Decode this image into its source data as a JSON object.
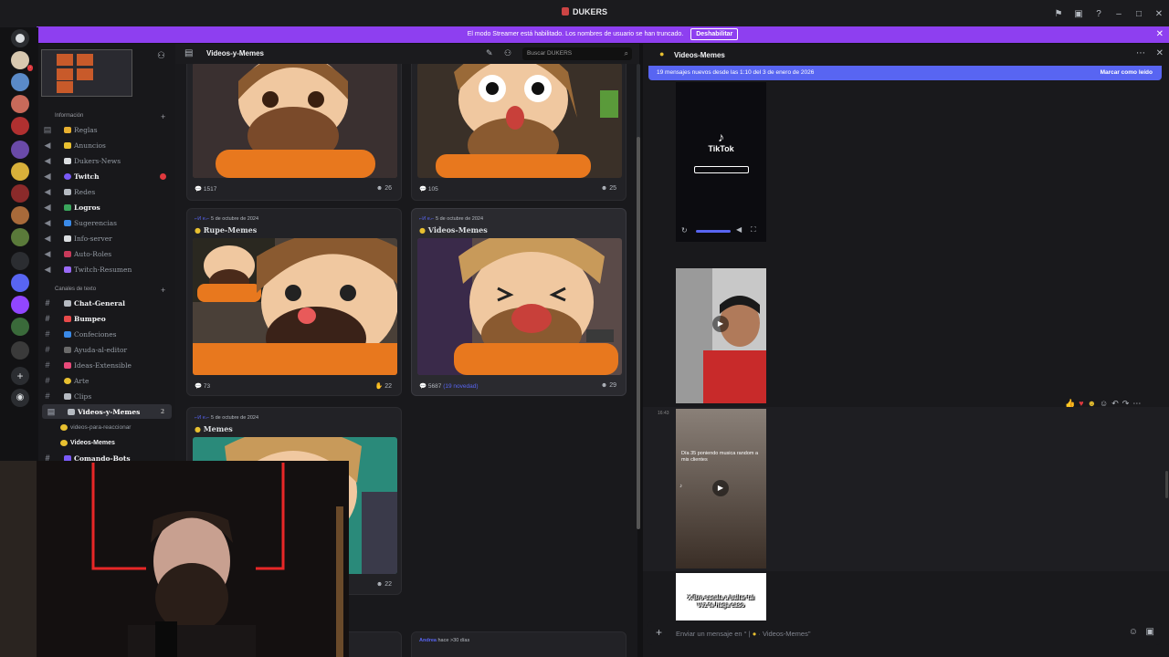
{
  "window": {
    "title": "DUKERS"
  },
  "banner": {
    "text": "El modo Streamer está habilitado. Los nombres de usuario se han truncado.",
    "button": "Deshabilitar"
  },
  "sidebar": {
    "categories": [
      {
        "label": "Información"
      },
      {
        "label": "Canales de texto"
      }
    ],
    "channels": [
      {
        "label": "Reglas"
      },
      {
        "label": "Anuncios"
      },
      {
        "label": "Dukers-News"
      },
      {
        "label": "Twitch"
      },
      {
        "label": "Redes"
      },
      {
        "label": "Logros"
      },
      {
        "label": "Sugerencias"
      },
      {
        "label": "Info-server"
      },
      {
        "label": "Auto-Roles"
      },
      {
        "label": "Twitch-Resumen"
      },
      {
        "label": "Chat-General"
      },
      {
        "label": "Bumpeo"
      },
      {
        "label": "Confeciones"
      },
      {
        "label": "Ayuda-al-editor"
      },
      {
        "label": "Ideas-Extensible"
      },
      {
        "label": "Arte"
      },
      {
        "label": "Clips"
      },
      {
        "label": "Videos-y-Memes",
        "count": "2"
      },
      {
        "label": "videos-para-reaccionar"
      },
      {
        "label": "Videos-Memes"
      },
      {
        "label": "Comando-Bots"
      }
    ]
  },
  "forum": {
    "title": "Videos-y-Memes",
    "search_placeholder": "Buscar DUKERS",
    "cards": [
      {
        "comments": "1517",
        "reactions": "26"
      },
      {
        "comments": "105",
        "reactions": "25"
      },
      {
        "date": "5 de octubre de 2024",
        "tag": "Rupe-Memes",
        "comments": "73",
        "reactions": "22"
      },
      {
        "date": "5 de octubre de 2024",
        "tag": "Videos-Memes",
        "comments": "5687",
        "new": "(19 novedad)",
        "reactions": "29"
      },
      {
        "date": "5 de octubre de 2024",
        "tag": "Memes",
        "reactions": "22"
      },
      {
        "author": "Andrea",
        "time": "hace >30 días"
      }
    ]
  },
  "chat": {
    "title": "Videos-Memes",
    "new_messages": "19 mensajes nuevos desde las 1:10 del 3 de enero de 2026",
    "mark_read": "Marcar como leído",
    "tiktok_label": "TikTok",
    "video_caption": "Día 35 poniendo musica random a mis clientes",
    "meme_caption": "X Bro sacala a bailar tal vez te haga caso",
    "time": "16:43",
    "input_placeholder": "Enviar un mensaje en",
    "input_channel": "Videos-Memes"
  },
  "colors": {
    "accent": "#8e3ff0",
    "blurple": "#5865f2",
    "orange": "#e07a1f"
  }
}
